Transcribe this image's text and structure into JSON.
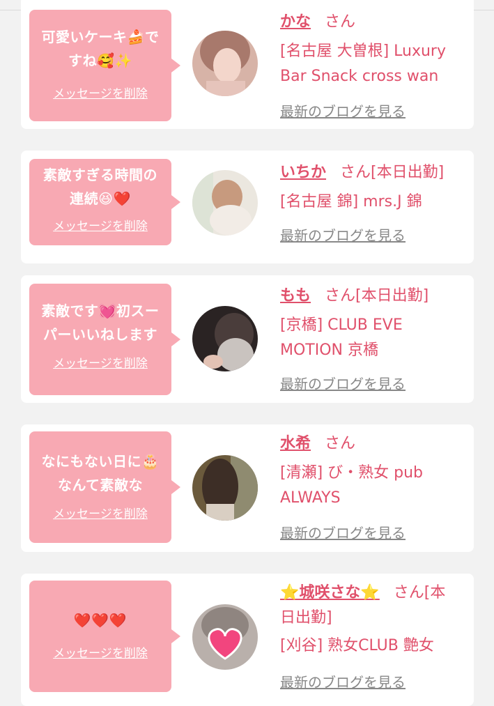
{
  "items": [
    {
      "message_lines": [
        "可愛いケーキ🍰で",
        "すね🥰✨"
      ],
      "delete_label": "メッセージを削除",
      "name": "かな",
      "honorific": "さん",
      "shop_lines": [
        "[名古屋 大曽根] Luxury",
        "Bar Snack cross wan"
      ],
      "blog_label": "最新のブログを見る"
    },
    {
      "message_lines": [
        "素敵すぎる時間の",
        "連続😆❤️"
      ],
      "delete_label": "メッセージを削除",
      "name": "いちか",
      "honorific": "さん[本日出勤]",
      "shop_lines": [
        "[名古屋 錦] mrs.J 錦"
      ],
      "blog_label": "最新のブログを見る"
    },
    {
      "message_lines": [
        "素敵です💓初スー",
        "パーいいねします"
      ],
      "delete_label": "メッセージを削除",
      "name": "もも",
      "honorific": "さん[本日出勤]",
      "shop_lines": [
        "[京橋] CLUB EVE",
        "MOTION 京橋"
      ],
      "blog_label": "最新のブログを見る"
    },
    {
      "message_lines": [
        "なにもない日に🎂",
        "なんて素敵な"
      ],
      "delete_label": "メッセージを削除",
      "name": "水希",
      "honorific": "さん",
      "shop_lines": [
        "[清瀬] び・熟女 pub",
        "ALWAYS"
      ],
      "blog_label": "最新のブログを見る"
    },
    {
      "message_lines": [
        "❤️❤️❤️"
      ],
      "delete_label": "メッセージを削除",
      "name": "⭐城咲さな⭐",
      "honorific": "さん[本",
      "honorific_line2": "日出勤]",
      "shop_lines": [
        "[刈谷] 熟女CLUB 艶女"
      ],
      "blog_label": "最新のブログを見る"
    }
  ],
  "colors": {
    "accent": "#e0506b",
    "bubble": "#f8a9b3",
    "link_gray": "#888888",
    "background": "#f2f2f2"
  }
}
